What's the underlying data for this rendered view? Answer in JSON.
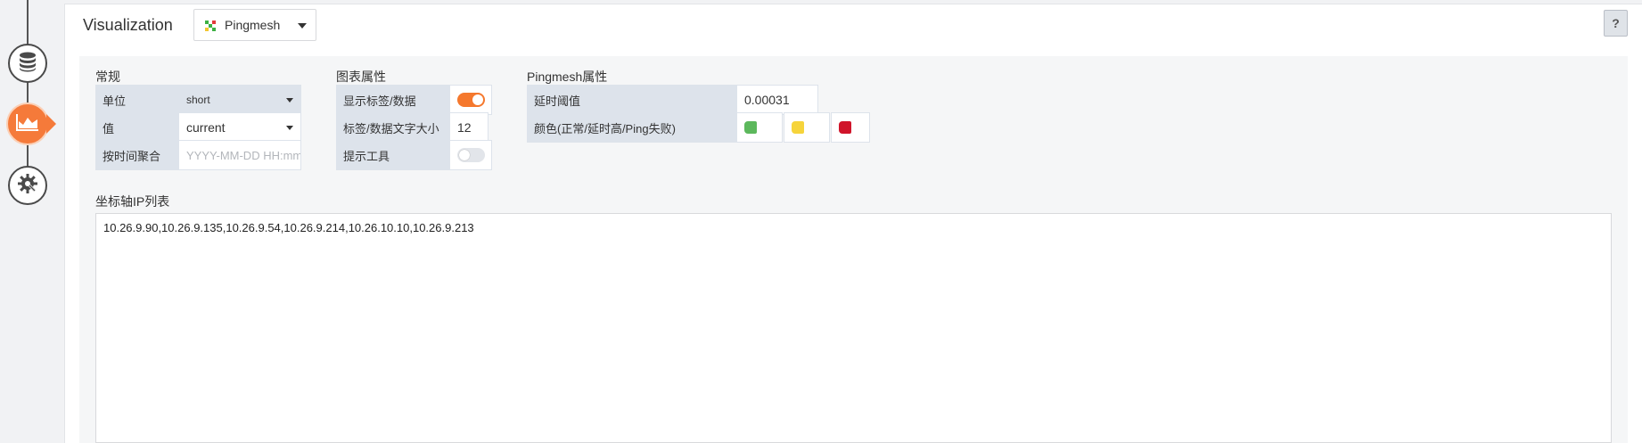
{
  "rail": {
    "items": [
      {
        "name": "data-source",
        "icon": "database-icon"
      },
      {
        "name": "visualization",
        "icon": "area-chart-icon",
        "active": true
      },
      {
        "name": "settings",
        "icon": "gear-wrench-icon"
      }
    ],
    "accent": "#f57a3a"
  },
  "header": {
    "title": "Visualization",
    "select_value": "Pingmesh",
    "select_icon": "pingmesh-grid-icon",
    "help_label": "?"
  },
  "general": {
    "title": "常规",
    "unit_label": "单位",
    "unit_value": "short",
    "value_label": "值",
    "value_value": "current",
    "aggregate_label": "按时间聚合",
    "aggregate_placeholder": "YYYY-MM-DD HH:mm..."
  },
  "chart_props": {
    "title": "图表属性",
    "show_labels_label": "显示标签/数据",
    "show_labels_on": true,
    "label_size_label": "标签/数据文字大小",
    "label_size_value": "12",
    "tooltip_label": "提示工具",
    "tooltip_on": false
  },
  "pingmesh_props": {
    "title": "Pingmesh属性",
    "threshold_label": "延时阈值",
    "threshold_value": "0.00031",
    "colors_label": "颜色(正常/延时高/Ping失败)",
    "colors": [
      "#5cb85c",
      "#f6d43b",
      "#d0142a"
    ]
  },
  "ip_list": {
    "title": "坐标轴IP列表",
    "value": "10.26.9.90,10.26.9.135,10.26.9.54,10.26.9.214,10.26.10.10,10.26.9.213"
  }
}
